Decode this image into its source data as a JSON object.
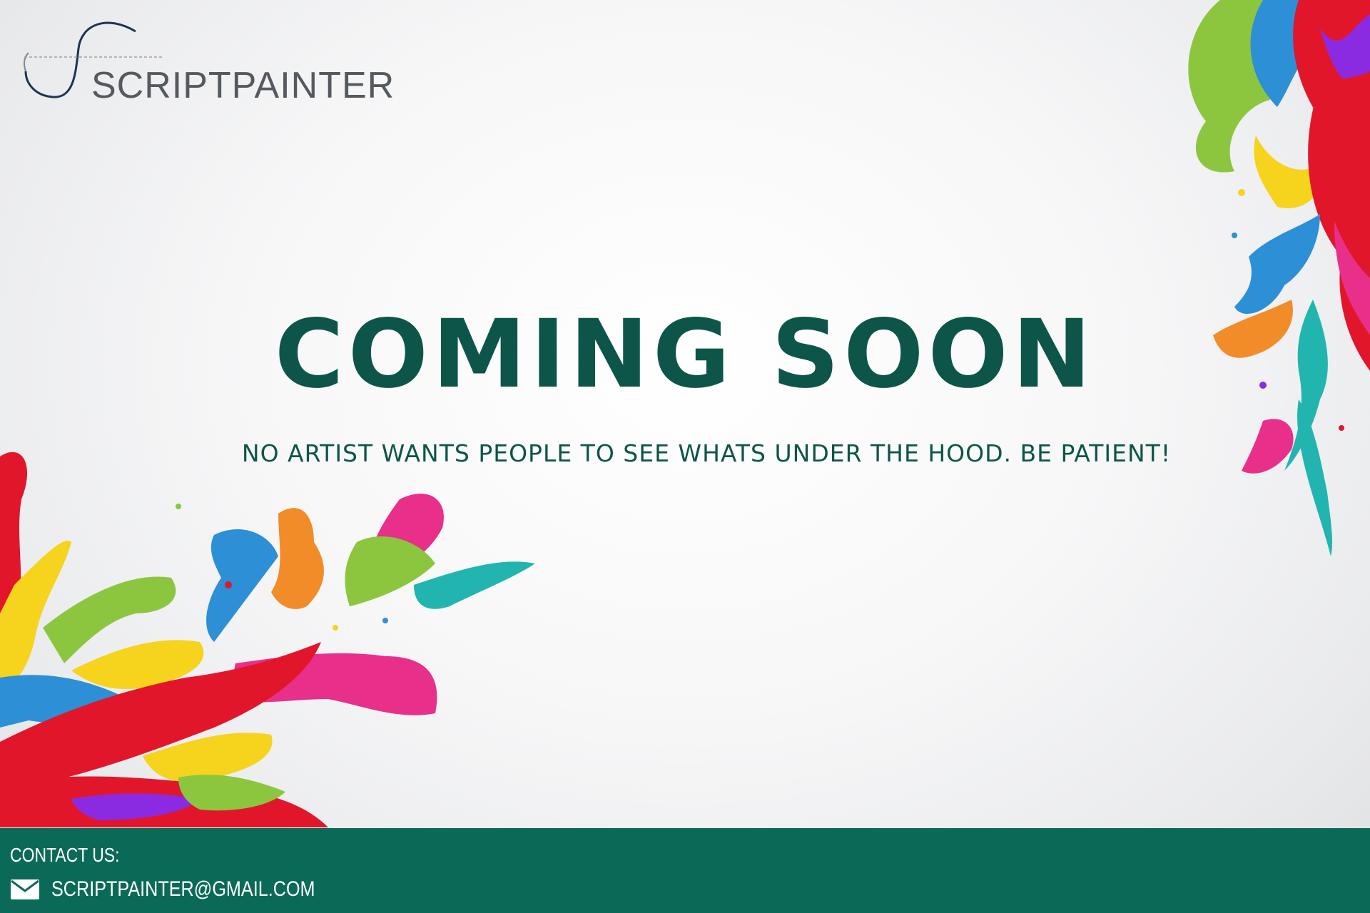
{
  "brand": {
    "name": "SCRIPTPAINTER",
    "logo_icon": "script-s-curve-icon"
  },
  "hero": {
    "title": "COMING SOON",
    "subtitle": "NO ARTIST WANTS PEOPLE TO SEE WHATS UNDER THE HOOD. BE PATIENT!",
    "text_color": "#0d5548"
  },
  "footer": {
    "background_color": "#0b6a57",
    "contact_label": "CONTACT US:",
    "email_icon": "envelope-icon",
    "email": "SCRIPTPAINTER@GMAIL.COM"
  },
  "decorations": {
    "paint_splash_colors": [
      "#e2162b",
      "#f6d31c",
      "#8cc63f",
      "#2d8fd5",
      "#f28c28",
      "#e8308a",
      "#22b5b0",
      "#8a2be2"
    ]
  }
}
